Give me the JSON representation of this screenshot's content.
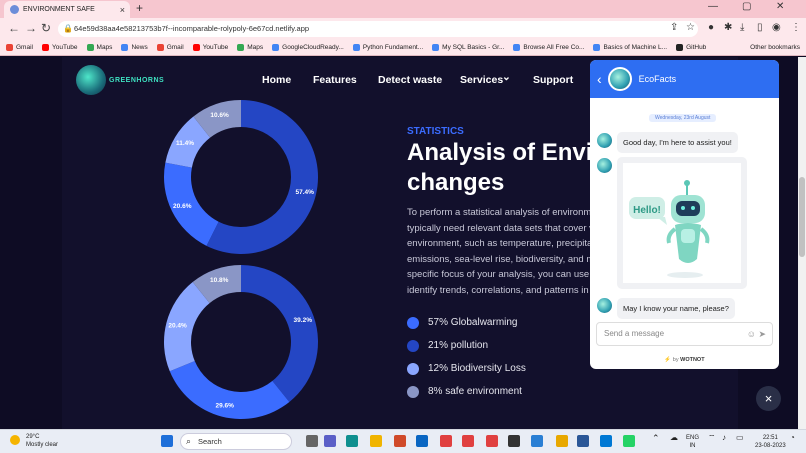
{
  "browser": {
    "tab_title": "ENVIRONMENT SAFE",
    "tab_close": "×",
    "new_tab": "+",
    "address": "64e59d38aa4e58213753b7f--incomparable-rolypoly-6e67cd.netlify.app",
    "bookmarks": [
      "Gmail",
      "YouTube",
      "Maps",
      "News",
      "Gmail",
      "YouTube",
      "Maps",
      "GoogleCloudReady...",
      "Python Fundament...",
      "My SQL Basics - Gr...",
      "Browse All Free Co...",
      "Basics of Machine L...",
      "GitHub"
    ],
    "all_bookmarks": "Other bookmarks"
  },
  "site": {
    "logo_text": "GREENHORNS",
    "nav": [
      "Home",
      "Features",
      "Detect waste",
      "Services",
      "Support"
    ],
    "services_caret": "⌄",
    "section_label": "STATISTICS",
    "headline_line1": "Analysis of Envi",
    "headline_line2": "changes",
    "paragraph_lines": [
      "To perform a statistical analysis of environm",
      "typically need relevant data sets that cover v",
      "environment, such as temperature, precipita",
      "emissions, sea-level rise, biodiversity, and m",
      "specific focus of your analysis, you can use",
      "identify trends, correlations, and patterns in"
    ],
    "legend": [
      {
        "label": "57% Globalwarming",
        "color": "#3b6cff"
      },
      {
        "label": "21% pollution",
        "color": "#2446c4"
      },
      {
        "label": "12% Biodiversity Loss",
        "color": "#8aa6ff"
      },
      {
        "label": "8% safe environment",
        "color": "#8a96c6"
      }
    ]
  },
  "chart_data": [
    {
      "type": "pie",
      "slices": [
        {
          "label": "57.4%",
          "value": 57.4,
          "color": "#2446c4"
        },
        {
          "label": "20.6%",
          "value": 20.6,
          "color": "#3b6cff"
        },
        {
          "label": "11.4%",
          "value": 11.4,
          "color": "#8aa6ff"
        },
        {
          "label": "10.6%",
          "value": 10.6,
          "color": "#8a96c6"
        }
      ]
    },
    {
      "type": "pie",
      "slices": [
        {
          "label": "39.2%",
          "value": 39.2,
          "color": "#2446c4"
        },
        {
          "label": "29.6%",
          "value": 29.6,
          "color": "#3b6cff"
        },
        {
          "label": "20.4%",
          "value": 20.4,
          "color": "#8aa6ff"
        },
        {
          "label": "10.8%",
          "value": 10.8,
          "color": "#8a96c6"
        }
      ]
    }
  ],
  "chat": {
    "back": "‹",
    "bot_name": "EcoFacts",
    "date": "Wednesday, 23rd August",
    "msg1": "Good day, I'm here to assist you!",
    "image_text": "Hello!",
    "msg2": "May I know your name, please?",
    "input_placeholder": "Send a message",
    "powered_prefix": "⚡ by",
    "powered_brand": "WOTNOT",
    "close": "×"
  },
  "taskbar": {
    "temp": "29°C",
    "weather": "Mostly clear",
    "search": "Search",
    "lang1": "ENG",
    "lang2": "IN",
    "time": "22:51",
    "date": "23-08-2023"
  }
}
